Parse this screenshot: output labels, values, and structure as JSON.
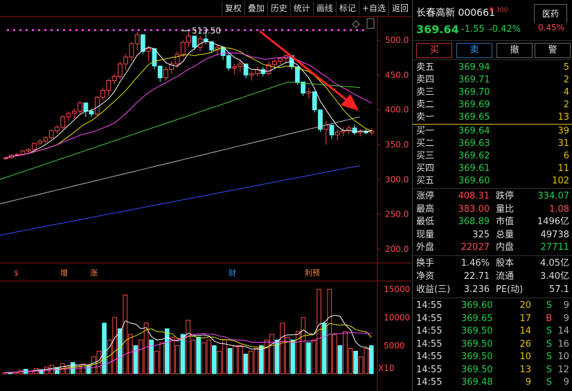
{
  "toolbar": {
    "items": [
      "复权",
      "叠加",
      "历史",
      "统计",
      "画线",
      "标记",
      "+自选",
      "返回"
    ]
  },
  "chart": {
    "price_axis": [
      "500.0",
      "450.0",
      "400.0",
      "350.0",
      "300.0",
      "250.0",
      "200.0"
    ],
    "vol_axis": [
      "15000",
      "10000",
      "5000"
    ],
    "vol_unit": "X10",
    "high_label": "513.50",
    "markers": [
      {
        "label": "$",
        "color": "#ff4a4a"
      },
      {
        "label": "增",
        "color": "#ff8a4a"
      },
      {
        "label": "涨",
        "color": "#ff8a4a"
      },
      {
        "label": "财",
        "color": "#2a9dff"
      },
      {
        "label": "利预",
        "color": "#ff8a4a"
      }
    ],
    "colors": {
      "up": "#ff4a4a",
      "down": "#5ef4f4",
      "ma5": "#ffffff",
      "ma10": "#e7e700",
      "ma20": "#ff4aff",
      "ma60": "#40d040",
      "ma120": "#bbbbbb",
      "ma250": "#3050ff",
      "arrow": "#ff2020"
    }
  },
  "chart_data": {
    "type": "candlestick",
    "ylim": [
      180,
      530
    ],
    "candles": [
      [
        330,
        333,
        328,
        331
      ],
      [
        331,
        336,
        330,
        335
      ],
      [
        335,
        338,
        333,
        336
      ],
      [
        336,
        342,
        334,
        341
      ],
      [
        341,
        345,
        338,
        343
      ],
      [
        343,
        353,
        342,
        352
      ],
      [
        352,
        358,
        349,
        355
      ],
      [
        355,
        362,
        352,
        360
      ],
      [
        360,
        372,
        358,
        370
      ],
      [
        370,
        378,
        366,
        375
      ],
      [
        375,
        392,
        372,
        390
      ],
      [
        390,
        398,
        384,
        395
      ],
      [
        395,
        402,
        388,
        398
      ],
      [
        398,
        412,
        395,
        410
      ],
      [
        410,
        404,
        390,
        398
      ],
      [
        398,
        402,
        390,
        394
      ],
      [
        394,
        420,
        392,
        418
      ],
      [
        418,
        432,
        414,
        428
      ],
      [
        428,
        445,
        420,
        442
      ],
      [
        442,
        452,
        436,
        448
      ],
      [
        448,
        470,
        444,
        466
      ],
      [
        466,
        480,
        458,
        476
      ],
      [
        476,
        498,
        470,
        495
      ],
      [
        495,
        512,
        486,
        508
      ],
      [
        508,
        499,
        480,
        484
      ],
      [
        484,
        492,
        470,
        488
      ],
      [
        488,
        482,
        458,
        463
      ],
      [
        463,
        458,
        440,
        446
      ],
      [
        446,
        462,
        442,
        458
      ],
      [
        458,
        470,
        452,
        466
      ],
      [
        466,
        484,
        460,
        480
      ],
      [
        480,
        500,
        476,
        497
      ],
      [
        497,
        512,
        490,
        506
      ],
      [
        506,
        498,
        486,
        490
      ],
      [
        490,
        506,
        484,
        502
      ],
      [
        502,
        513.5,
        494,
        498
      ],
      [
        498,
        496,
        482,
        486
      ],
      [
        486,
        494,
        478,
        490
      ],
      [
        490,
        488,
        472,
        478
      ],
      [
        478,
        482,
        456,
        460
      ],
      [
        460,
        466,
        450,
        462
      ],
      [
        462,
        470,
        455,
        466
      ],
      [
        466,
        460,
        445,
        450
      ],
      [
        450,
        456,
        442,
        452
      ],
      [
        452,
        462,
        448,
        458
      ],
      [
        458,
        462,
        448,
        452
      ],
      [
        452,
        470,
        450,
        465
      ],
      [
        465,
        472,
        460,
        470
      ],
      [
        470,
        476,
        466,
        474
      ],
      [
        474,
        480,
        468,
        478
      ],
      [
        478,
        470,
        458,
        462
      ],
      [
        462,
        455,
        436,
        440
      ],
      [
        440,
        438,
        420,
        424
      ],
      [
        424,
        432,
        416,
        426
      ],
      [
        426,
        420,
        396,
        400
      ],
      [
        400,
        392,
        368,
        372
      ],
      [
        372,
        384,
        350,
        378
      ],
      [
        378,
        370,
        358,
        364
      ],
      [
        364,
        372,
        356,
        368
      ],
      [
        368,
        375,
        362,
        370
      ],
      [
        370,
        378,
        365,
        374
      ],
      [
        374,
        379,
        364,
        367
      ],
      [
        367,
        372,
        362,
        369
      ],
      [
        369,
        372,
        365,
        367
      ],
      [
        367,
        374,
        364,
        369.64
      ]
    ],
    "volume": [
      200,
      250,
      300,
      600,
      800,
      400,
      900,
      700,
      1200,
      1500,
      1100,
      1800,
      1300,
      2000,
      1500,
      1700,
      1400,
      3000,
      4000,
      9000,
      6000,
      10000,
      8000,
      14000,
      7000,
      5000,
      6000,
      9000,
      6000,
      4000,
      5500,
      8000,
      6500,
      5000,
      7000,
      9500,
      6000,
      6500,
      5500,
      6000,
      5000,
      4000,
      6000,
      4500,
      5000,
      5000,
      3500,
      4000,
      4500,
      5000,
      6000,
      7000,
      6000,
      9000,
      6500,
      6000,
      7500,
      10000,
      5500,
      6000,
      15000,
      9000,
      15000,
      7000,
      5000,
      7500,
      4500,
      4000,
      3000,
      4500,
      5000
    ]
  },
  "quote": {
    "name": "长春高新",
    "code": "000661",
    "badge": "R 300",
    "sector": "医药",
    "sector_pct": "0.45%",
    "price": "369.64",
    "change": "-1.55",
    "change_pct": "-0.42%"
  },
  "trade_buttons": [
    "买",
    "卖",
    "撤",
    "警"
  ],
  "order_book": {
    "asks": [
      {
        "label": "卖五",
        "price": "369.94",
        "vol": "5"
      },
      {
        "label": "卖四",
        "price": "369.71",
        "vol": "2"
      },
      {
        "label": "卖三",
        "price": "369.70",
        "vol": "4"
      },
      {
        "label": "卖二",
        "price": "369.69",
        "vol": "2"
      },
      {
        "label": "卖一",
        "price": "369.65",
        "vol": "13"
      }
    ],
    "bids": [
      {
        "label": "买一",
        "price": "369.64",
        "vol": "39"
      },
      {
        "label": "买二",
        "price": "369.63",
        "vol": "31"
      },
      {
        "label": "买三",
        "price": "369.62",
        "vol": "6"
      },
      {
        "label": "买四",
        "price": "369.61",
        "vol": "11"
      },
      {
        "label": "买五",
        "price": "369.60",
        "vol": "102"
      }
    ]
  },
  "stats": [
    {
      "l1": "涨停",
      "v1": "408.31",
      "c1": "r",
      "l2": "跌停",
      "v2": "334.07",
      "c2": "g"
    },
    {
      "l1": "最高",
      "v1": "383.00",
      "c1": "r",
      "l2": "量比",
      "v2": "1.08",
      "c2": "r"
    },
    {
      "l1": "最低",
      "v1": "368.89",
      "c1": "g",
      "l2": "市值",
      "v2": "1496亿",
      "c2": "w"
    },
    {
      "l1": "现量",
      "v1": "325",
      "c1": "w",
      "l2": "总量",
      "v2": "49738",
      "c2": "w"
    },
    {
      "l1": "外盘",
      "v1": "22027",
      "c1": "r",
      "l2": "内盘",
      "v2": "27711",
      "c2": "g"
    }
  ],
  "stats2": [
    {
      "l1": "换手",
      "v1": "1.46%",
      "l2": "股本",
      "v2": "4.05亿"
    },
    {
      "l1": "净资",
      "v1": "22.71",
      "l2": "流通",
      "v2": "3.40亿"
    },
    {
      "l1": "收益(三)",
      "v1": "3.236",
      "l2": "PE(动)",
      "v2": "57.1"
    }
  ],
  "ticks": [
    {
      "time": "14:55",
      "price": "369.60",
      "vol": "20",
      "bs": "S",
      "n": "9"
    },
    {
      "time": "14:55",
      "price": "369.65",
      "vol": "17",
      "bs": "B",
      "n": "9"
    },
    {
      "time": "14:55",
      "price": "369.50",
      "vol": "14",
      "bs": "S",
      "n": "14"
    },
    {
      "time": "14:55",
      "price": "369.50",
      "vol": "26",
      "bs": "S",
      "n": "16"
    },
    {
      "time": "14:55",
      "price": "369.50",
      "vol": "10",
      "bs": "S",
      "n": "10"
    },
    {
      "time": "14:55",
      "price": "369.50",
      "vol": "13",
      "bs": "S",
      "n": "12"
    },
    {
      "time": "14:55",
      "price": "369.48",
      "vol": "9",
      "bs": "S",
      "n": "9"
    }
  ]
}
